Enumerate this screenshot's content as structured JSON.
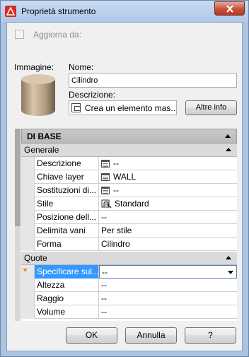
{
  "window": {
    "title": "Proprietà strumento"
  },
  "update": {
    "label": "Aggiorna da:",
    "checked": false
  },
  "image": {
    "label": "Immagine:"
  },
  "name": {
    "label": "Nome:",
    "value": "Cilindro"
  },
  "description": {
    "label": "Descrizione:",
    "value": "Crea un elemento mas..."
  },
  "more_button": "Altre info",
  "grid": {
    "section": "DI BASE",
    "general": {
      "label": "Generale",
      "props": [
        {
          "key": "Descrizione",
          "value": "--",
          "icon": "table-icon"
        },
        {
          "key": "Chiave layer",
          "value": "WALL",
          "icon": "table-icon"
        },
        {
          "key": "Sostituzioni di...",
          "value": "--",
          "icon": "table-icon"
        },
        {
          "key": "Stile",
          "value": "Standard",
          "icon": "style-icon"
        },
        {
          "key": "Posizione dell...",
          "value": "--"
        },
        {
          "key": "Delimita vani",
          "value": "Per stile"
        },
        {
          "key": "Forma",
          "value": "Cilindro"
        }
      ]
    },
    "dims": {
      "label": "Quote",
      "props": [
        {
          "key": "Specificare sul...",
          "value": "--",
          "selected": true,
          "marker": "*"
        },
        {
          "key": "Altezza",
          "value": "--"
        },
        {
          "key": "Raggio",
          "value": "--"
        },
        {
          "key": "Volume",
          "value": "--"
        }
      ]
    }
  },
  "buttons": {
    "ok": "OK",
    "cancel": "Annulla",
    "help": "?"
  },
  "colors": {
    "accent": "#3399ff",
    "title_bar": "#aac4e2",
    "close": "#c75239"
  }
}
